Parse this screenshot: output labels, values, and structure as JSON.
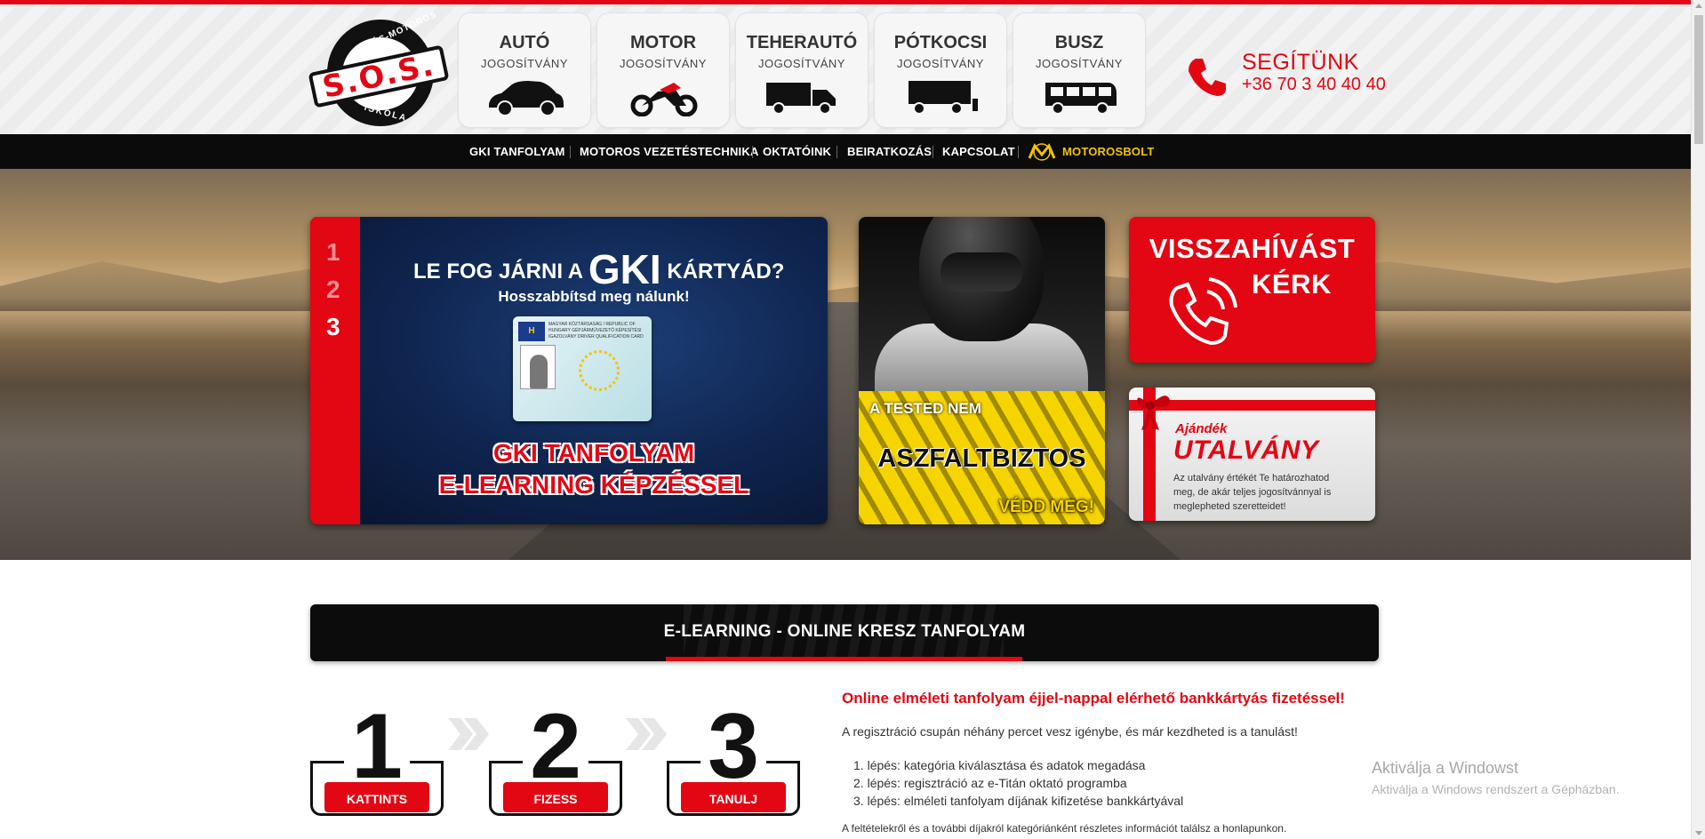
{
  "brand": {
    "logo_top": "AUTÓS-MOTOROS",
    "logo_main": "S.O.S.",
    "logo_bottom": "ISKOLA",
    "accent_color": "#e30613",
    "shop_color": "#f3c300"
  },
  "categories": [
    {
      "title": "AUTÓ",
      "subtitle": "JOGOSÍTVÁNY",
      "icon": "car-icon"
    },
    {
      "title": "MOTOR",
      "subtitle": "JOGOSÍTVÁNY",
      "icon": "motorcycle-icon"
    },
    {
      "title": "TEHERAUTÓ",
      "subtitle": "JOGOSÍTVÁNY",
      "icon": "truck-icon"
    },
    {
      "title": "PÓTKOCSI",
      "subtitle": "JOGOSÍTVÁNY",
      "icon": "trailer-icon"
    },
    {
      "title": "BUSZ",
      "subtitle": "JOGOSÍTVÁNY",
      "icon": "bus-icon"
    }
  ],
  "help": {
    "title": "SEGÍTÜNK",
    "phone": "+36 70 3 40 40 40",
    "icon": "phone-icon"
  },
  "nav": {
    "items": [
      "GKI TANFOLYAM",
      "MOTOROS VEZETÉSTECHNIKA",
      "OKTATÓINK",
      "BEIRATKOZÁS",
      "KAPCSOLAT"
    ],
    "shop": "MOTOROSBOLT"
  },
  "hero": {
    "gki": {
      "steps": [
        "1",
        "2",
        "3"
      ],
      "active_step": 3,
      "headline_pre": "LE FOG JÁRNI A",
      "headline_big": "GKI",
      "headline_post": "KÁRTYÁD?",
      "subline": "Hosszabbítsd meg nálunk!",
      "card_flag": "H",
      "card_text": "MAGYAR KÖZTÁRSASÁG / REPUBLIC OF HUNGARY GÉPJÁRMŰVEZETŐ KÉPESÍTÉSI IGAZOLVÁNY DRIVER QUALIFICATION CARD",
      "cta_line1": "GKI TANFOLYAM",
      "cta_line2": "E-LEARNING KÉPZÉSSEL"
    },
    "moto": {
      "line1": "A TESTED NEM",
      "line2": "ASZFALTBIZTOS",
      "line3": "VÉDD MEG!"
    },
    "callback": {
      "line1": "VISSZAHÍVÁST",
      "line2": "KÉRK"
    },
    "gift": {
      "line1": "Ajándék",
      "line2": "UTALVÁNY",
      "desc": "Az utalvány értékét Te határozhatod meg, de akár teljes jogosítvánnyal is meglepheted szeretteidet!"
    }
  },
  "elearning": {
    "band_title": "E-LEARNING - ONLINE KRESZ TANFOLYAM",
    "steps": [
      {
        "digit": "1",
        "label": "KATTINTS"
      },
      {
        "digit": "2",
        "label": "FIZESS"
      },
      {
        "digit": "3",
        "label": "TANULJ"
      }
    ],
    "headline": "Online elméleti tanfolyam éjjel-nappal elérhető bankkártyás fizetéssel!",
    "intro": "A regisztráció csupán néhány percet vesz igénybe, és már kezdheted is a tanulást!",
    "list": [
      "lépés: kategória kiválasztása és adatok megadása",
      "lépés: regisztráció az e-Titán oktató programba",
      "lépés: elméleti tanfolyam díjának kifizetése bankkártyával"
    ],
    "footnote": "A feltételekről és a további díjakról kategóriánként részletes információt találsz a honlapunkon."
  },
  "watermark": {
    "line1": "Aktiválja a Windowst",
    "line2": "Aktiválja a Windows rendszert a Gépházban."
  }
}
